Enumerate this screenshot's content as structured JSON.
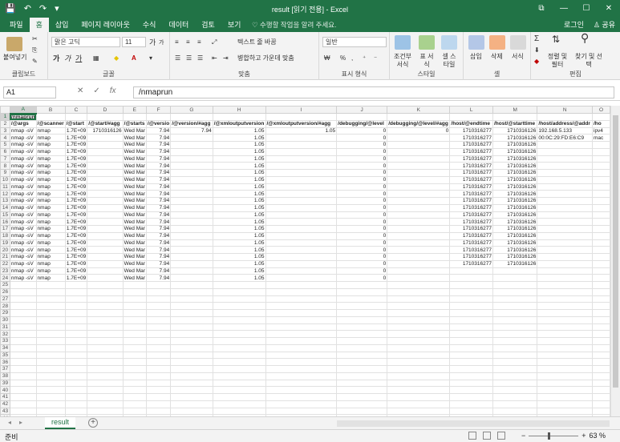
{
  "window": {
    "title": "result  [읽기 전용] - Excel",
    "controls": [
      "⧉",
      "—",
      "☐",
      "✕"
    ],
    "qat": [
      "💾",
      "↶",
      "↷",
      "▾"
    ]
  },
  "tabs": [
    "파일",
    "홈",
    "삽입",
    "페이지 레이아웃",
    "수식",
    "데이터",
    "검토",
    "보기"
  ],
  "tell_me": "♡ 수행할 작업을 알려 주세요.",
  "account": {
    "login": "로그인",
    "share": "♙ 공유"
  },
  "ribbon": {
    "clipboard": {
      "label": "클립보드",
      "paste": "붙여넣기"
    },
    "font": {
      "label": "글꼴",
      "name": "맑은 고딕",
      "size": "11",
      "bold": "가",
      "italic": "가",
      "underline": "가",
      "grow": "가",
      "shrink": "가"
    },
    "alignment": {
      "label": "맞춤",
      "wrap": "텍스트 줄 바꿈",
      "merge": "병합하고 가운데 맞춤"
    },
    "number": {
      "label": "표시 형식",
      "format": "일반",
      "percent": "%",
      "comma": ","
    },
    "styles": {
      "label": "스타일",
      "conditional": "조건부 서식",
      "table": "표 서식",
      "cell": "셀 스타일"
    },
    "cells": {
      "label": "셀",
      "insert": "삽입",
      "delete": "삭제",
      "format": "서식"
    },
    "editing": {
      "label": "편집",
      "sort": "정렬 및 필터",
      "find": "찾기 및 선택"
    }
  },
  "formula_bar": {
    "name_box": "A1",
    "fx": "fx",
    "value": "/nmaprun"
  },
  "columns": [
    "A",
    "B",
    "C",
    "D",
    "E",
    "F",
    "G",
    "H",
    "I",
    "J",
    "K",
    "L",
    "M",
    "N",
    "O"
  ],
  "row_count": 25,
  "rows": [
    [
      "/nmaprun",
      "",
      "",
      "",
      "",
      "",
      "",
      "",
      "",
      "",
      "",
      "",
      "",
      "",
      ""
    ],
    [
      "/@args",
      "/@scanner",
      "/@start",
      "/@start/#agg",
      "/@starts",
      "/@versio",
      "/@version/#agg",
      "/@xmloutputversion",
      "/@xmloutputversion/#agg",
      "/debugging/@level",
      "/debugging/@level/#agg",
      "/host/@endtime",
      "/host/@starttime",
      "/host/address/@addr",
      "/ho"
    ],
    [
      "nmap -sV",
      "nmap",
      "1.7E+09",
      "1710316126",
      "Wed Mar",
      "7.94",
      "7.94",
      "1.05",
      "1.05",
      "0",
      "0",
      "1710316277",
      "1710316126",
      "192.168.5.133",
      "ipv4"
    ],
    [
      "nmap -sV",
      "nmap",
      "1.7E+09",
      "",
      "Wed Mar",
      "7.94",
      "",
      "1.05",
      "",
      "0",
      "",
      "1710316277",
      "1710316126",
      "00:0C:29:FD:E6:C9",
      "mac"
    ],
    [
      "nmap -sV",
      "nmap",
      "1.7E+09",
      "",
      "Wed Mar",
      "7.94",
      "",
      "1.05",
      "",
      "0",
      "",
      "1710316277",
      "1710316126",
      "",
      ""
    ],
    [
      "nmap -sV",
      "nmap",
      "1.7E+09",
      "",
      "Wed Mar",
      "7.94",
      "",
      "1.05",
      "",
      "0",
      "",
      "1710316277",
      "1710316126",
      "",
      ""
    ],
    [
      "nmap -sV",
      "nmap",
      "1.7E+09",
      "",
      "Wed Mar",
      "7.94",
      "",
      "1.05",
      "",
      "0",
      "",
      "1710316277",
      "1710316126",
      "",
      ""
    ],
    [
      "nmap -sV",
      "nmap",
      "1.7E+09",
      "",
      "Wed Mar",
      "7.94",
      "",
      "1.05",
      "",
      "0",
      "",
      "1710316277",
      "1710316126",
      "",
      ""
    ],
    [
      "nmap -sV",
      "nmap",
      "1.7E+09",
      "",
      "Wed Mar",
      "7.94",
      "",
      "1.05",
      "",
      "0",
      "",
      "1710316277",
      "1710316126",
      "",
      ""
    ],
    [
      "nmap -sV",
      "nmap",
      "1.7E+09",
      "",
      "Wed Mar",
      "7.94",
      "",
      "1.05",
      "",
      "0",
      "",
      "1710316277",
      "1710316126",
      "",
      ""
    ],
    [
      "nmap -sV",
      "nmap",
      "1.7E+09",
      "",
      "Wed Mar",
      "7.94",
      "",
      "1.05",
      "",
      "0",
      "",
      "1710316277",
      "1710316126",
      "",
      ""
    ],
    [
      "nmap -sV",
      "nmap",
      "1.7E+09",
      "",
      "Wed Mar",
      "7.94",
      "",
      "1.05",
      "",
      "0",
      "",
      "1710316277",
      "1710316126",
      "",
      ""
    ],
    [
      "nmap -sV",
      "nmap",
      "1.7E+09",
      "",
      "Wed Mar",
      "7.94",
      "",
      "1.05",
      "",
      "0",
      "",
      "1710316277",
      "1710316126",
      "",
      ""
    ],
    [
      "nmap -sV",
      "nmap",
      "1.7E+09",
      "",
      "Wed Mar",
      "7.94",
      "",
      "1.05",
      "",
      "0",
      "",
      "1710316277",
      "1710316126",
      "",
      ""
    ],
    [
      "nmap -sV",
      "nmap",
      "1.7E+09",
      "",
      "Wed Mar",
      "7.94",
      "",
      "1.05",
      "",
      "0",
      "",
      "1710316277",
      "1710316126",
      "",
      ""
    ],
    [
      "nmap -sV",
      "nmap",
      "1.7E+09",
      "",
      "Wed Mar",
      "7.94",
      "",
      "1.05",
      "",
      "0",
      "",
      "1710316277",
      "1710316126",
      "",
      ""
    ],
    [
      "nmap -sV",
      "nmap",
      "1.7E+09",
      "",
      "Wed Mar",
      "7.94",
      "",
      "1.05",
      "",
      "0",
      "",
      "1710316277",
      "1710316126",
      "",
      ""
    ],
    [
      "nmap -sV",
      "nmap",
      "1.7E+09",
      "",
      "Wed Mar",
      "7.94",
      "",
      "1.05",
      "",
      "0",
      "",
      "1710316277",
      "1710316126",
      "",
      ""
    ],
    [
      "nmap -sV",
      "nmap",
      "1.7E+09",
      "",
      "Wed Mar",
      "7.94",
      "",
      "1.05",
      "",
      "0",
      "",
      "1710316277",
      "1710316126",
      "",
      ""
    ],
    [
      "nmap -sV",
      "nmap",
      "1.7E+09",
      "",
      "Wed Mar",
      "7.94",
      "",
      "1.05",
      "",
      "0",
      "",
      "1710316277",
      "1710316126",
      "",
      ""
    ],
    [
      "nmap -sV",
      "nmap",
      "1.7E+09",
      "",
      "Wed Mar",
      "7.94",
      "",
      "1.05",
      "",
      "0",
      "",
      "1710316277",
      "1710316126",
      "",
      ""
    ],
    [
      "nmap -sV",
      "nmap",
      "1.7E+09",
      "",
      "Wed Mar",
      "7.94",
      "",
      "1.05",
      "",
      "0",
      "",
      "1710316277",
      "1710316126",
      "",
      ""
    ],
    [
      "nmap -sV",
      "nmap",
      "1.7E+09",
      "",
      "Wed Mar",
      "7.94",
      "",
      "1.05",
      "",
      "0",
      "",
      "",
      "",
      "",
      ""
    ],
    [
      "nmap -sV",
      "nmap",
      "1.7E+09",
      "",
      "Wed Mar",
      "7.94",
      "",
      "1.05",
      "",
      "0",
      "",
      "",
      "",
      "",
      ""
    ]
  ],
  "sheet_tab": "result",
  "status": {
    "ready": "준비",
    "zoom": "63 %",
    "minus": "−",
    "plus": "+"
  }
}
